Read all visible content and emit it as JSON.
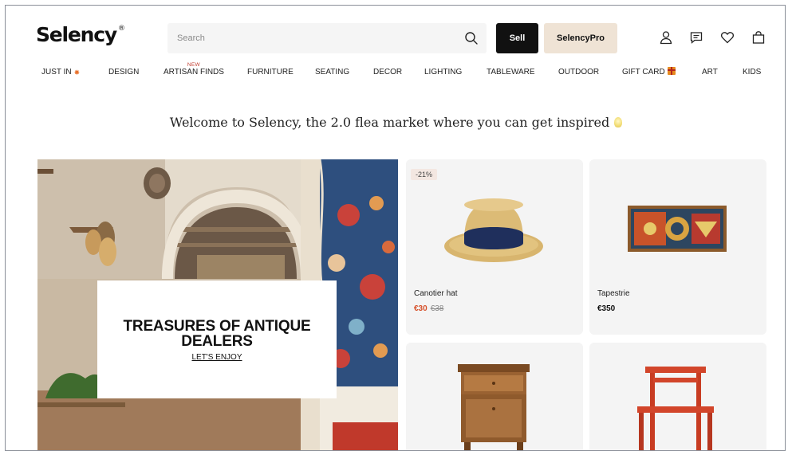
{
  "brand": {
    "logo": "Selency",
    "logo_mark": "®"
  },
  "search": {
    "placeholder": "Search",
    "icon": "search-icon"
  },
  "header": {
    "sell_label": "Sell",
    "pro_label": "SelencyPro",
    "icons": [
      "user-icon",
      "messages-icon",
      "heart-icon",
      "bag-icon"
    ]
  },
  "nav": {
    "items": [
      {
        "label": "JUST IN",
        "icon": "sparkle-icon"
      },
      {
        "label": "DESIGN"
      },
      {
        "label": "ARTISAN FINDS",
        "badge": "NEW"
      },
      {
        "label": "FURNITURE"
      },
      {
        "label": "SEATING"
      },
      {
        "label": "DECOR"
      },
      {
        "label": "LIGHTING"
      },
      {
        "label": "TABLEWARE"
      },
      {
        "label": "OUTDOOR"
      },
      {
        "label": "GIFT CARD",
        "icon": "gift-icon"
      },
      {
        "label": "ART"
      },
      {
        "label": "KIDS"
      }
    ]
  },
  "welcome": {
    "text": "Welcome to Selency, the 2.0 flea market where you can get inspired",
    "icon": "lightbulb-icon"
  },
  "hero": {
    "title": "TREASURES OF ANTIQUE DEALERS",
    "link": "LET'S ENJOY"
  },
  "products": [
    {
      "name": "Canotier hat",
      "price": "€30",
      "old_price": "€38",
      "discount": "-21%"
    },
    {
      "name": "Tapestrie",
      "price": "€350"
    },
    {
      "name": "",
      "price": ""
    },
    {
      "name": "",
      "price": ""
    }
  ],
  "colors": {
    "accent": "#111111",
    "pro_bg": "#efe3d5",
    "sale": "#d6502a",
    "card_bg": "#f4f4f4"
  }
}
